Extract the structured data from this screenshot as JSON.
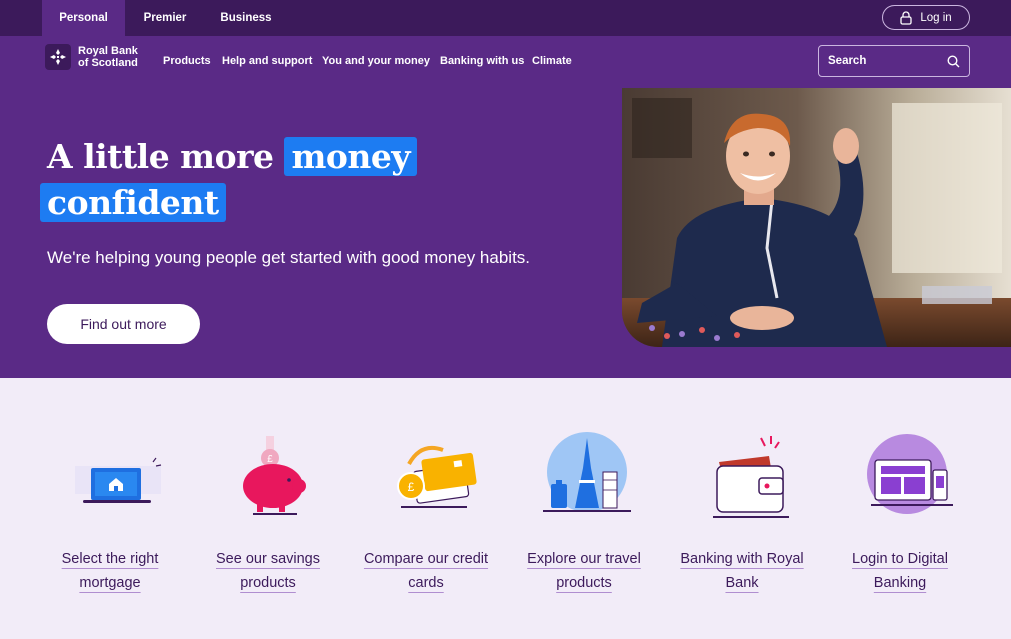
{
  "top_tabs": [
    "Personal",
    "Premier",
    "Business"
  ],
  "login_label": "Log in",
  "brand": {
    "line1": "Royal Bank",
    "line2": "of Scotland"
  },
  "nav": [
    "Products",
    "Help and support",
    "You and your money",
    "Banking with us",
    "Climate"
  ],
  "search": {
    "label": "Search"
  },
  "hero": {
    "title_part1": "A little more",
    "title_highlight1": "money",
    "title_highlight2": "confident",
    "subtitle": "We're helping young people get started with good money habits.",
    "cta": "Find out more"
  },
  "cards": [
    {
      "line1": "Select the right",
      "line2": "mortgage",
      "icon": "laptop-house-icon"
    },
    {
      "line1": "See our savings",
      "line2": "products",
      "icon": "piggy-bank-icon"
    },
    {
      "line1": "Compare our credit",
      "line2": "cards",
      "icon": "credit-cards-icon"
    },
    {
      "line1": "Explore our travel",
      "line2": "products",
      "icon": "travel-landmarks-icon"
    },
    {
      "line1": "Banking with Royal",
      "line2": "Bank",
      "icon": "wallet-icon"
    },
    {
      "line1": "Login to Digital",
      "line2": "Banking",
      "icon": "digital-devices-icon"
    }
  ],
  "colors": {
    "dark_purple": "#3c1a5b",
    "purple": "#5a2a86",
    "highlight_blue": "#1d7cf2",
    "page_bg": "#f2ecf8"
  }
}
